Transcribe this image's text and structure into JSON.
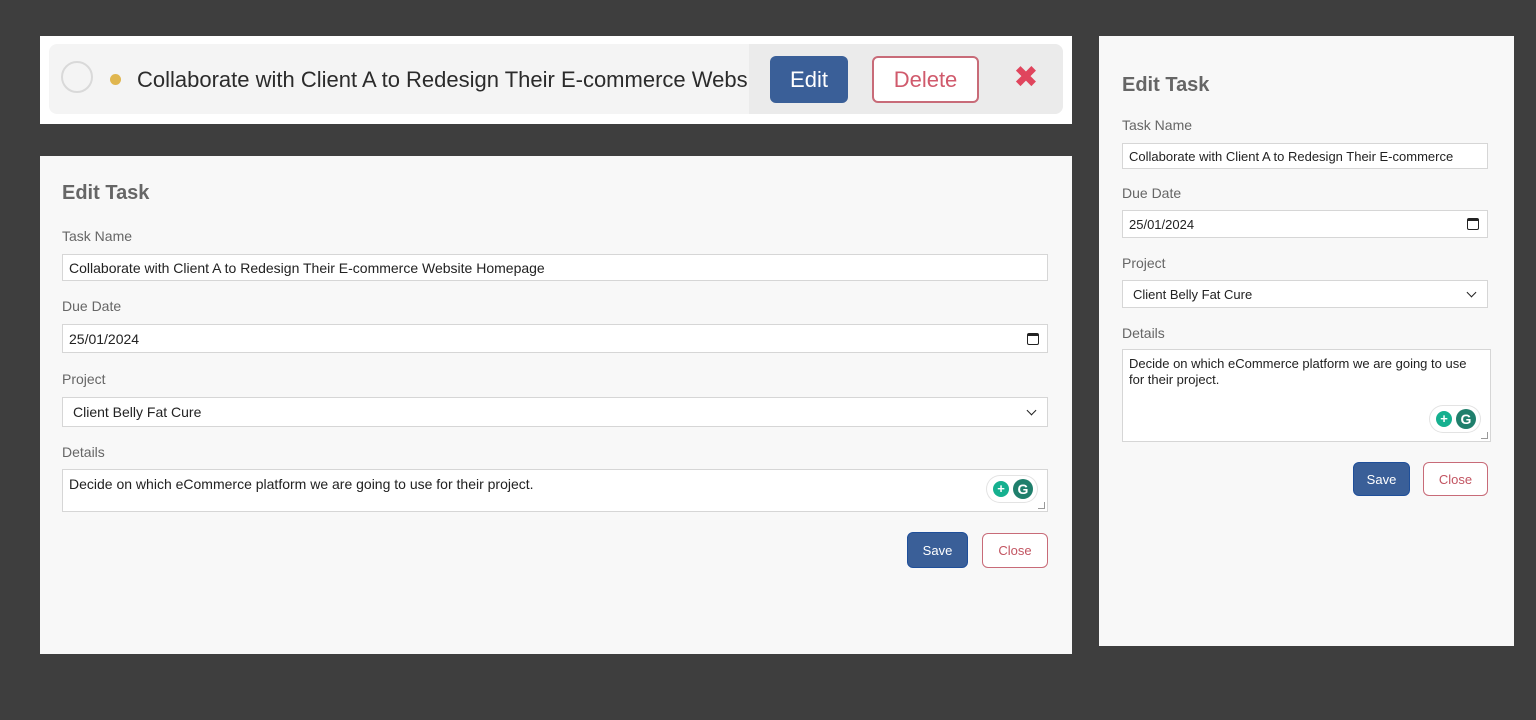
{
  "task_row": {
    "title": "Collaborate with Client A to Redesign Their E-commerce Website Homepage",
    "edit_label": "Edit",
    "delete_label": "Delete",
    "close_glyph": "✖",
    "priority_color": "#e0b64f"
  },
  "edit_form_large": {
    "heading": "Edit Task",
    "task_name_label": "Task Name",
    "task_name_value": "Collaborate with Client A to Redesign Their E-commerce Website Homepage",
    "due_date_label": "Due Date",
    "due_date_value": "25/01/2024",
    "project_label": "Project",
    "project_value": "Client Belly Fat Cure",
    "details_label": "Details",
    "details_value": "Decide on which eCommerce platform we are going to use for their project.",
    "save_label": "Save",
    "close_label": "Close"
  },
  "edit_form_small": {
    "heading": "Edit Task",
    "task_name_label": "Task Name",
    "task_name_value": "Collaborate with Client A to Redesign Their E-commerce",
    "due_date_label": "Due Date",
    "due_date_value": "25/01/2024",
    "project_label": "Project",
    "project_value": "Client Belly Fat Cure",
    "details_label": "Details",
    "details_value": "Decide on which eCommerce platform we are going to use for their project.",
    "save_label": "Save",
    "close_label": "Close"
  },
  "colors": {
    "primary": "#3a5f98",
    "danger": "#c86b78",
    "background": "#3e3e3e"
  },
  "icons": {
    "grammar_bulb": "+",
    "grammar_logo": "G"
  }
}
